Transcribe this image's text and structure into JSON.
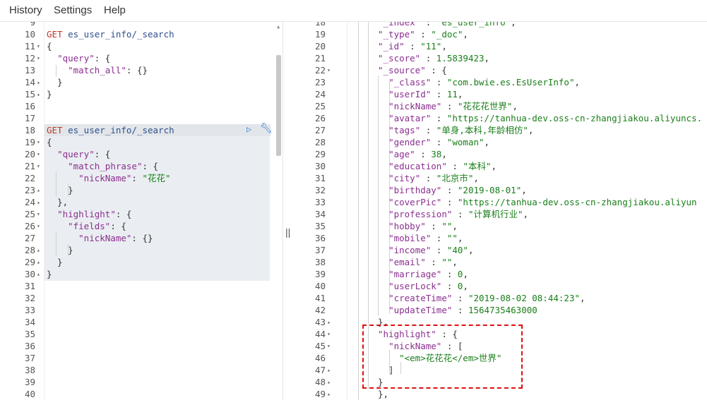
{
  "menu": {
    "history": "History",
    "settings": "Settings",
    "help": "Help"
  },
  "splitter_glyph": "||",
  "request_lines": [
    {
      "n": "9",
      "f": "",
      "html": ""
    },
    {
      "n": "10",
      "f": "",
      "html": "<span class='m'>GET</span> <span class='u'>es_user_info/_search</span>"
    },
    {
      "n": "11",
      "f": "▾",
      "html": "{"
    },
    {
      "n": "12",
      "f": "▾",
      "html": "  <span class='k'>\"query\"</span>: {"
    },
    {
      "n": "13",
      "f": "",
      "html": "    <span class='k'>\"match_all\"</span>: {}"
    },
    {
      "n": "14",
      "f": "▴",
      "html": "  }"
    },
    {
      "n": "15",
      "f": "▴",
      "html": "}"
    },
    {
      "n": "16",
      "f": "",
      "html": ""
    },
    {
      "n": "17",
      "f": "",
      "html": ""
    },
    {
      "n": "18",
      "f": "",
      "html": "<span class='m'>GET</span> <span class='u'>es_user_info/_search</span>"
    },
    {
      "n": "19",
      "f": "▾",
      "html": "{"
    },
    {
      "n": "20",
      "f": "▾",
      "html": "  <span class='k'>\"query\"</span>: {"
    },
    {
      "n": "21",
      "f": "▾",
      "html": "    <span class='k'>\"match_phrase\"</span>: {"
    },
    {
      "n": "22",
      "f": "",
      "html": "      <span class='k'>\"nickName\"</span>: <span class='s'>\"花花\"</span>"
    },
    {
      "n": "23",
      "f": "▴",
      "html": "    }"
    },
    {
      "n": "24",
      "f": "▴",
      "html": "  },"
    },
    {
      "n": "25",
      "f": "▾",
      "html": "  <span class='k'>\"highlight\"</span>: {"
    },
    {
      "n": "26",
      "f": "▾",
      "html": "    <span class='k'>\"fields\"</span>: {"
    },
    {
      "n": "27",
      "f": "",
      "html": "      <span class='k'>\"nickName\"</span>: {}"
    },
    {
      "n": "28",
      "f": "▴",
      "html": "    }"
    },
    {
      "n": "29",
      "f": "▴",
      "html": "  }"
    },
    {
      "n": "30",
      "f": "▴",
      "html": "}"
    },
    {
      "n": "31",
      "f": "",
      "html": ""
    },
    {
      "n": "32",
      "f": "",
      "html": ""
    },
    {
      "n": "33",
      "f": "",
      "html": ""
    },
    {
      "n": "34",
      "f": "",
      "html": ""
    },
    {
      "n": "35",
      "f": "",
      "html": ""
    },
    {
      "n": "36",
      "f": "",
      "html": ""
    },
    {
      "n": "37",
      "f": "",
      "html": ""
    },
    {
      "n": "38",
      "f": "",
      "html": ""
    },
    {
      "n": "39",
      "f": "",
      "html": ""
    },
    {
      "n": "40",
      "f": "",
      "html": ""
    }
  ],
  "response_lines": [
    {
      "n": "18",
      "f": "",
      "html": "<span class='k'>\"_index\"</span> : <span class='s'>\"es_user_info\"</span>,"
    },
    {
      "n": "19",
      "f": "",
      "html": "<span class='k'>\"_type\"</span> : <span class='s'>\"_doc\"</span>,"
    },
    {
      "n": "20",
      "f": "",
      "html": "<span class='k'>\"_id\"</span> : <span class='s'>\"11\"</span>,"
    },
    {
      "n": "21",
      "f": "",
      "html": "<span class='k'>\"_score\"</span> : <span class='n'>1.5839423</span>,"
    },
    {
      "n": "22",
      "f": "▾",
      "html": "<span class='k'>\"_source\"</span> : {"
    },
    {
      "n": "23",
      "f": "",
      "html": "  <span class='k'>\"_class\"</span> : <span class='s'>\"com.bwie.es.EsUserInfo\"</span>,"
    },
    {
      "n": "24",
      "f": "",
      "html": "  <span class='k'>\"userId\"</span> : <span class='n'>11</span>,"
    },
    {
      "n": "25",
      "f": "",
      "html": "  <span class='k'>\"nickName\"</span> : <span class='s'>\"花花花世界\"</span>,"
    },
    {
      "n": "26",
      "f": "",
      "html": "  <span class='k'>\"avatar\"</span> : <span class='s'>\"https://tanhua-dev.oss-cn-zhangjiakou.aliyuncs.</span>"
    },
    {
      "n": "27",
      "f": "",
      "html": "  <span class='k'>\"tags\"</span> : <span class='s'>\"单身,本科,年龄相仿\"</span>,"
    },
    {
      "n": "28",
      "f": "",
      "html": "  <span class='k'>\"gender\"</span> : <span class='s'>\"woman\"</span>,"
    },
    {
      "n": "29",
      "f": "",
      "html": "  <span class='k'>\"age\"</span> : <span class='n'>38</span>,"
    },
    {
      "n": "30",
      "f": "",
      "html": "  <span class='k'>\"education\"</span> : <span class='s'>\"本科\"</span>,"
    },
    {
      "n": "31",
      "f": "",
      "html": "  <span class='k'>\"city\"</span> : <span class='s'>\"北京市\"</span>,"
    },
    {
      "n": "32",
      "f": "",
      "html": "  <span class='k'>\"birthday\"</span> : <span class='s'>\"2019-08-01\"</span>,"
    },
    {
      "n": "33",
      "f": "",
      "html": "  <span class='k'>\"coverPic\"</span> : <span class='s'>\"https://tanhua-dev.oss-cn-zhangjiakou.aliyun</span>"
    },
    {
      "n": "34",
      "f": "",
      "html": "  <span class='k'>\"profession\"</span> : <span class='s'>\"计算机行业\"</span>,"
    },
    {
      "n": "35",
      "f": "",
      "html": "  <span class='k'>\"hobby\"</span> : <span class='s'>\"\"</span>,"
    },
    {
      "n": "36",
      "f": "",
      "html": "  <span class='k'>\"mobile\"</span> : <span class='s'>\"\"</span>,"
    },
    {
      "n": "37",
      "f": "",
      "html": "  <span class='k'>\"income\"</span> : <span class='s'>\"40\"</span>,"
    },
    {
      "n": "38",
      "f": "",
      "html": "  <span class='k'>\"email\"</span> : <span class='s'>\"\"</span>,"
    },
    {
      "n": "39",
      "f": "",
      "html": "  <span class='k'>\"marriage\"</span> : <span class='n'>0</span>,"
    },
    {
      "n": "40",
      "f": "",
      "html": "  <span class='k'>\"userLock\"</span> : <span class='n'>0</span>,"
    },
    {
      "n": "41",
      "f": "",
      "html": "  <span class='k'>\"createTime\"</span> : <span class='s'>\"2019-08-02 08:44:23\"</span>,"
    },
    {
      "n": "42",
      "f": "",
      "html": "  <span class='k'>\"updateTime\"</span> : <span class='n'>1564735463000</span>"
    },
    {
      "n": "43",
      "f": "▴",
      "html": "},"
    },
    {
      "n": "44",
      "f": "▾",
      "html": "<span class='k'>\"highlight\"</span> : {"
    },
    {
      "n": "45",
      "f": "▾",
      "html": "  <span class='k'>\"nickName\"</span> : ["
    },
    {
      "n": "46",
      "f": "",
      "html": "    <span class='s'>\"&lt;em&gt;花花花&lt;/em&gt;世界\"</span>"
    },
    {
      "n": "47",
      "f": "▴",
      "html": "  ]"
    },
    {
      "n": "48",
      "f": "▴",
      "html": "}"
    },
    {
      "n": "49",
      "f": "▴",
      "html": "},"
    }
  ]
}
